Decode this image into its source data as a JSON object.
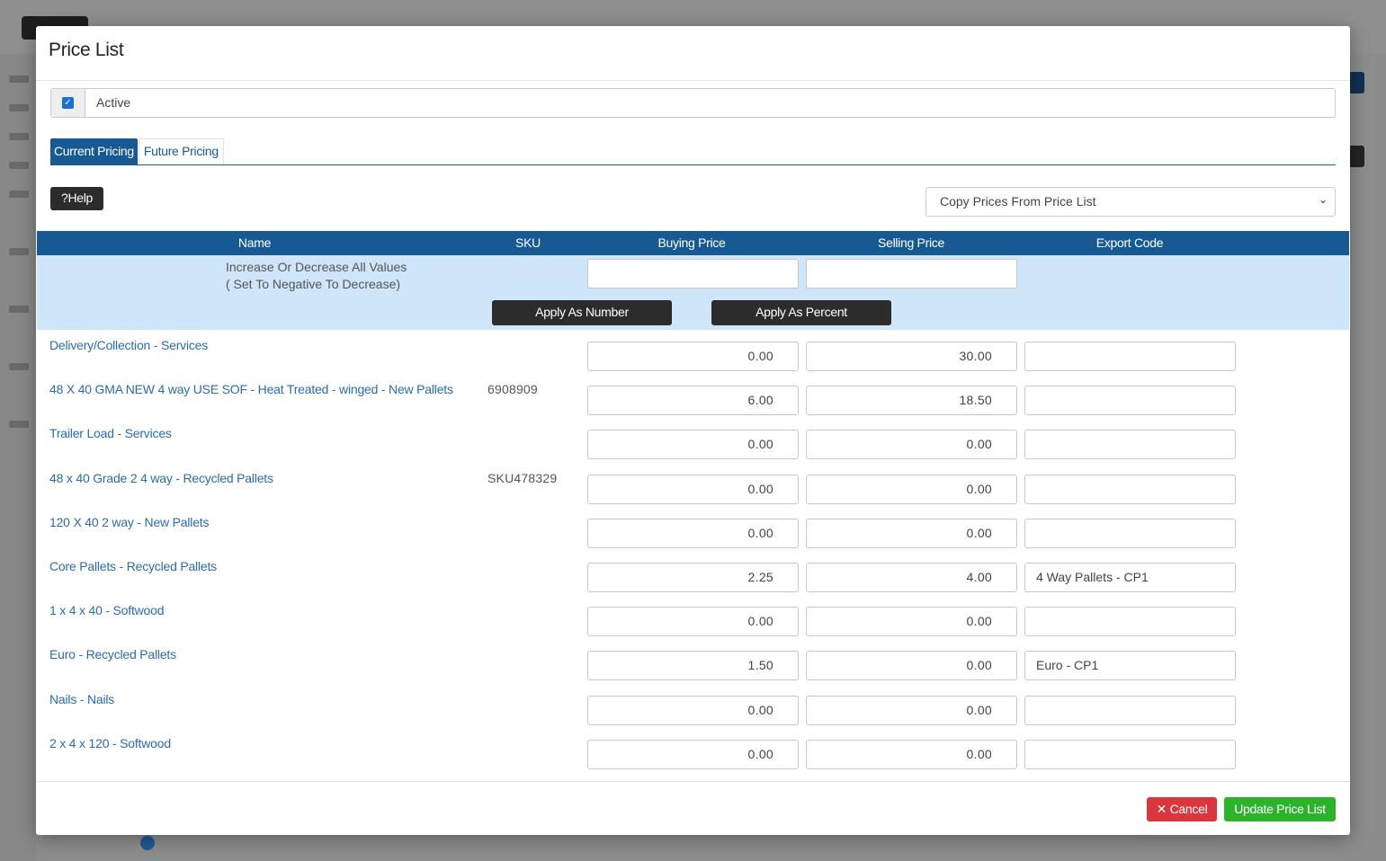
{
  "modal": {
    "title": "Price List",
    "active_label": "Active",
    "active_checked": true,
    "check_glyph": "✓"
  },
  "tabs": [
    {
      "label": "Current Pricing",
      "active": true
    },
    {
      "label": "Future Pricing",
      "active": false
    }
  ],
  "toolbar": {
    "help_label": "?Help",
    "copy_select_value": "Copy Prices From Price List",
    "caret_glyph": "⌄"
  },
  "table": {
    "headers": {
      "name": "Name",
      "sku": "SKU",
      "buying": "Buying Price",
      "selling": "Selling Price",
      "export": "Export Code"
    },
    "bulk_label": "Increase Or Decrease All Values\n( Set To Negative To Decrease)",
    "apply_number_label": "Apply As Number",
    "apply_percent_label": "Apply As Percent",
    "rows": [
      {
        "name": "Delivery/Collection - Services",
        "sku": "",
        "buy": "0.00",
        "sell": "30.00",
        "export": ""
      },
      {
        "name": "48 X 40 GMA NEW 4 way USE SOF - Heat Treated - winged - New Pallets",
        "sku": "6908909",
        "buy": "6.00",
        "sell": "18.50",
        "export": ""
      },
      {
        "name": "Trailer Load - Services",
        "sku": "",
        "buy": "0.00",
        "sell": "0.00",
        "export": ""
      },
      {
        "name": "48 x 40 Grade 2 4 way - Recycled Pallets",
        "sku": "SKU478329",
        "buy": "0.00",
        "sell": "0.00",
        "export": ""
      },
      {
        "name": "120 X 40 2 way - New Pallets",
        "sku": "",
        "buy": "0.00",
        "sell": "0.00",
        "export": ""
      },
      {
        "name": "Core Pallets - Recycled Pallets",
        "sku": "",
        "buy": "2.25",
        "sell": "4.00",
        "export": "4 Way Pallets - CP1"
      },
      {
        "name": "1 x 4 x 40 - Softwood",
        "sku": "",
        "buy": "0.00",
        "sell": "0.00",
        "export": ""
      },
      {
        "name": "Euro - Recycled Pallets",
        "sku": "",
        "buy": "1.50",
        "sell": "0.00",
        "export": "Euro - CP1"
      },
      {
        "name": "Nails - Nails",
        "sku": "",
        "buy": "0.00",
        "sell": "0.00",
        "export": ""
      },
      {
        "name": "2 x 4 x 120 - Softwood",
        "sku": "",
        "buy": "0.00",
        "sell": "0.00",
        "export": ""
      }
    ]
  },
  "footer": {
    "cancel_label": "✕ Cancel",
    "update_label": "Update Price List"
  },
  "colors": {
    "primary": "#175a93",
    "bulk_bg": "#cfe5fa",
    "cancel": "#d9363e",
    "update": "#2db32b",
    "link": "#2a6cae"
  }
}
